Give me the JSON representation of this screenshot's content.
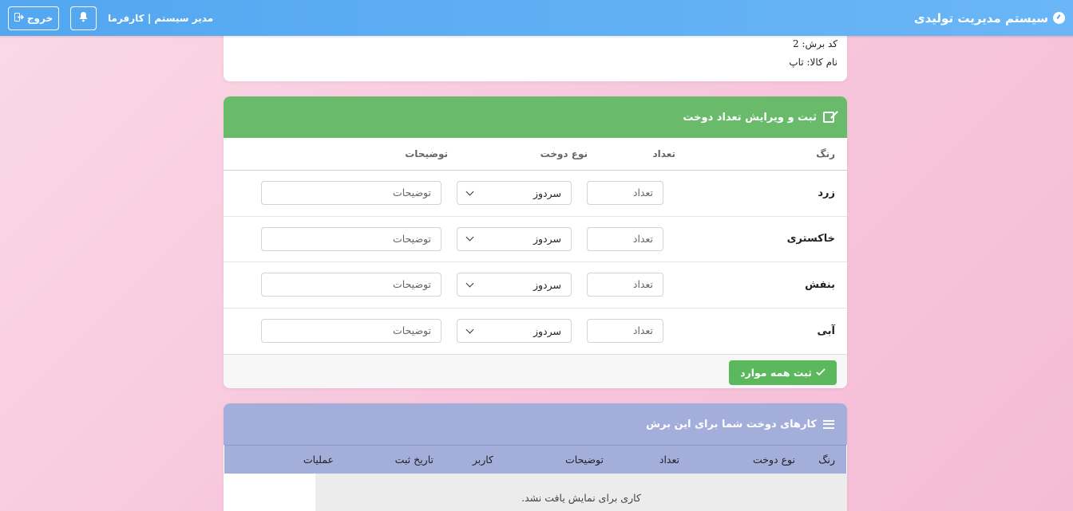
{
  "navbar": {
    "brand": "سیستم مدیریت تولیدی",
    "user": "مدیر سیستم | کارفرما",
    "logout_label": "خروج"
  },
  "info": {
    "code_label": "کد برش:",
    "code_value": "2",
    "name_label": "نام کالا:",
    "name_value": "تاپ"
  },
  "form": {
    "title": "ثبت و ویرایش تعداد دوخت",
    "headers": {
      "color": "رنگ",
      "count": "تعداد",
      "type": "نوع دوخت",
      "desc": "توضیحات"
    },
    "rows": [
      {
        "color": "زرد",
        "count_placeholder": "تعداد",
        "type": "سردوز",
        "desc_placeholder": "توضیحات"
      },
      {
        "color": "خاکستری",
        "count_placeholder": "تعداد",
        "type": "سردوز",
        "desc_placeholder": "توضیحات"
      },
      {
        "color": "بنفش",
        "count_placeholder": "تعداد",
        "type": "سردوز",
        "desc_placeholder": "توضیحات"
      },
      {
        "color": "آبی",
        "count_placeholder": "تعداد",
        "type": "سردوز",
        "desc_placeholder": "توضیحات"
      }
    ],
    "submit_label": "ثبت همه موارد"
  },
  "jobs": {
    "title": "کارهای دوخت شما برای این برش",
    "columns": [
      "رنگ",
      "نوع دوخت",
      "تعداد",
      "توضیحات",
      "کاربر",
      "تاریخ ثبت",
      "عملیات"
    ],
    "empty_message": "کاری برای نمایش یافت نشد."
  },
  "colors": {
    "navbar": "#53a7f0",
    "form_header": "#69bb6b",
    "submit_button": "#5cb85c",
    "jobs_header": "#a4aedb"
  }
}
